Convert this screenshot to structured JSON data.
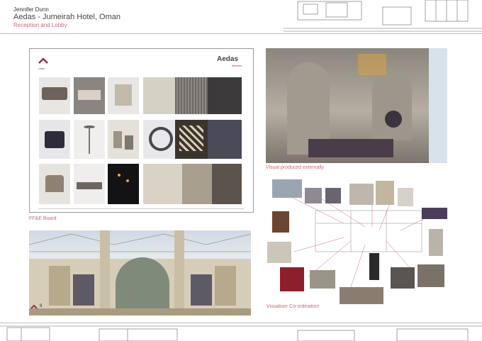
{
  "header": {
    "designer": "Jennifer Dunn",
    "project": "Aedas - Jumeirah Hotel, Oman",
    "subtitle": "Reception and Lobby"
  },
  "board": {
    "logo_text": "Aedas",
    "logo_sub": "interiors",
    "section_label": "LOBBY",
    "caption": "FF&E Board"
  },
  "render": {
    "caption": "Visual produced externally"
  },
  "collage": {
    "caption": "Visualiser Co-ordination"
  },
  "elevation": {
    "page_number": "8"
  },
  "colors": {
    "accent": "#c76a78",
    "brand_mark": "#9e2b49"
  }
}
